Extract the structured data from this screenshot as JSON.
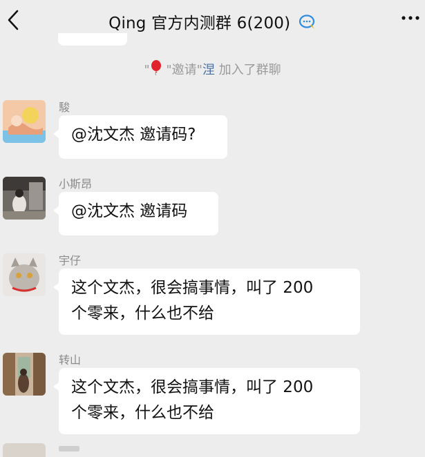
{
  "header": {
    "title": "Qing 官方内测群 6(200)",
    "back_icon": "chevron-left-icon",
    "more_icon": "more-dots-icon",
    "badge_icon": "chat-bubble-icon"
  },
  "system_message": {
    "quote_open": "\"",
    "inviter": "\"邀请\"",
    "invitee": "涅",
    "suffix": "加入了群聊",
    "icon": "balloon-icon"
  },
  "messages": [
    {
      "sender": "駿",
      "text": "@沈文杰 邀请码?"
    },
    {
      "sender": "小斯昂",
      "text": "@沈文杰 邀请码"
    },
    {
      "sender": "宇仔",
      "text_line1": "这个文杰，很会搞事情，叫了 200",
      "text_line2": "个零来，什么也不给"
    },
    {
      "sender": "转山",
      "text_line1": "这个文杰，很会搞事情，叫了 200",
      "text_line2": "个零来，什么也不给"
    }
  ],
  "colors": {
    "background": "#ededed",
    "bubble": "#ffffff",
    "link": "#4a6fa5",
    "system_text": "#9a9a9a"
  }
}
